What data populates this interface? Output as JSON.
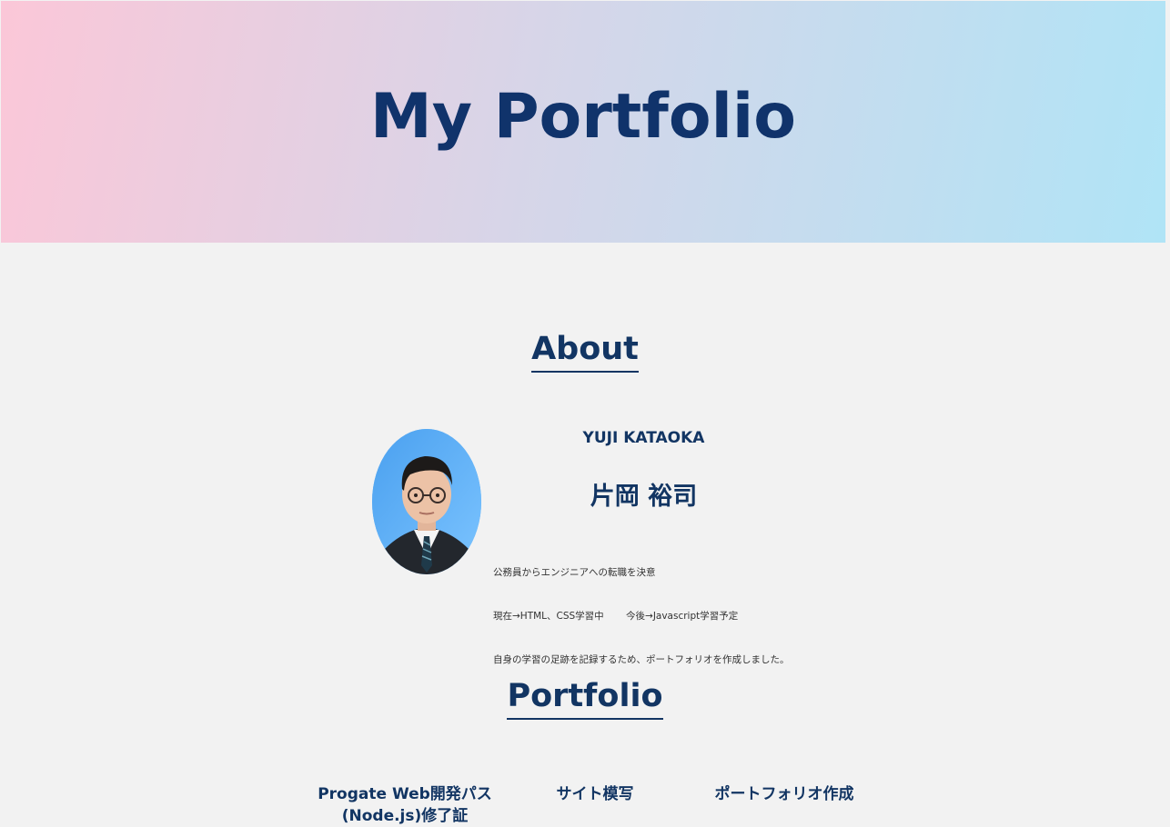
{
  "hero": {
    "title": "My Portfolio"
  },
  "about": {
    "heading": "About",
    "name_en": "YUJI KATAOKA",
    "name_jp": "片岡 裕司",
    "bio": [
      "公務員からエンジニアへの転職を決意",
      "現在→HTML、CSS学習中　　 今後→Javascript学習予定",
      "自身の学習の足跡を記録するため、ポートフォリオを作成しました。"
    ]
  },
  "portfolio": {
    "heading": "Portfolio",
    "items": [
      {
        "title": "Progate Web開発パス\n(Node.js)修了証"
      },
      {
        "title": "サイト模写"
      },
      {
        "title": "ポートフォリオ作成"
      }
    ]
  },
  "colors": {
    "navy": "#123563",
    "background": "#f2f2f2",
    "gradient_start": "#fbc7d8",
    "gradient_end": "#b0e4f6"
  }
}
